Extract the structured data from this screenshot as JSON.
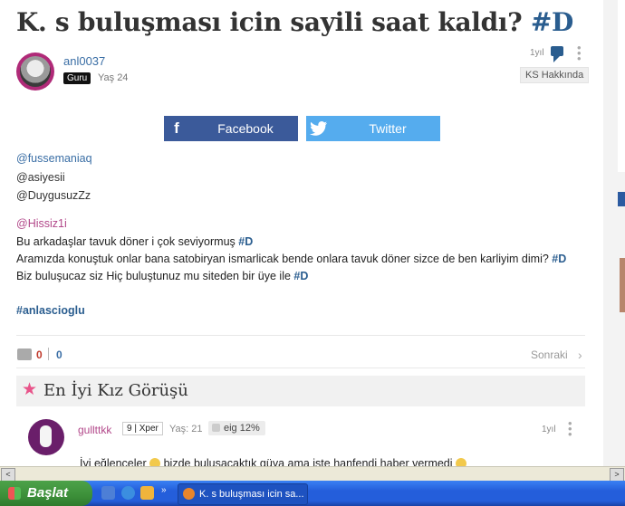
{
  "question": {
    "title": "K. s buluşması icin sayili saat kaldı?",
    "title_tag": "#D",
    "author": "anl0037",
    "badge": "Guru",
    "age": "Yaş 24",
    "time": "1yıl",
    "topic": "KS Hakkında"
  },
  "share": {
    "facebook": "Facebook",
    "twitter": "Twitter",
    "fb_icon": "f"
  },
  "body": {
    "mentions": [
      "@fussemaniaq",
      "@asiyesii",
      "@DuygusuzZz"
    ],
    "mention_pink": "@Hissiz1i",
    "line1": "Bu arkadaşlar tavuk döner i çok seviyormuş ",
    "line2": "Aramızda konuştuk onlar bana satobiryan ismarlicak bende onlara tavuk döner sizce de ben karliyim dimi? ",
    "line3": "Biz buluşucaz siz Hiç buluştunuz mu siteden bir üye ile ",
    "tag": "#D",
    "hashtag": "#anlascioglu"
  },
  "actions": {
    "likes": "0",
    "separator": "|",
    "dislikes": "0",
    "next": "Sonraki",
    "next_chevron": "›"
  },
  "best": {
    "label": "En İyi Kız Görüşü",
    "star": "★"
  },
  "answer": {
    "user": "gullttkk",
    "level_num": "9",
    "level": "Xper",
    "age": "Yaş: 21",
    "percent": "eig 12%",
    "time": "1yıl",
    "text_before": "İyi eğlenceler ",
    "text_after": " bizde bulusacaktık güya ama iste hanfendi haber vermedi "
  },
  "taskbar": {
    "start": "Başlat",
    "chevron": "»",
    "task": "K. s buluşması icin sa..."
  },
  "scrollbar": {
    "left": "<",
    "right": ">"
  },
  "colors": {
    "accent": "#2a5d8f",
    "facebook": "#3b5a9a",
    "twitter": "#55acee",
    "pink": "#b2488a",
    "star": "#e8548a"
  },
  "icons": [
    "chat-icon",
    "more-icon",
    "facebook-icon",
    "twitter-icon",
    "thumbs-up-icon",
    "chevron-right-icon",
    "star-icon",
    "smile-icon",
    "windows-flag-icon",
    "firefox-icon"
  ]
}
